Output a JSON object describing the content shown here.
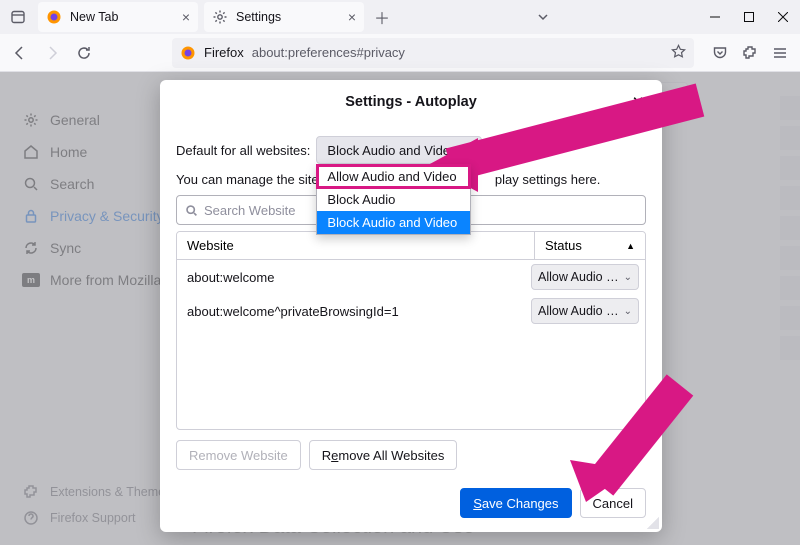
{
  "tabs": [
    {
      "label": "New Tab"
    },
    {
      "label": "Settings"
    }
  ],
  "addressbar": {
    "identity": "Firefox",
    "url": "about:preferences#privacy"
  },
  "sidebar": {
    "items": [
      {
        "label": "General"
      },
      {
        "label": "Home"
      },
      {
        "label": "Search"
      },
      {
        "label": "Privacy & Security"
      },
      {
        "label": "Sync"
      },
      {
        "label": "More from Mozilla"
      }
    ],
    "bottom": [
      {
        "label": "Extensions & Themes"
      },
      {
        "label": "Firefox Support"
      }
    ]
  },
  "ghost_heading": "Firefox Data Collection and Use",
  "modal": {
    "title": "Settings - Autoplay",
    "default_label": "Default for all websites:",
    "default_value": "Block Audio and Video",
    "default_options": [
      "Allow Audio and Video",
      "Block Audio",
      "Block Audio and Video"
    ],
    "manage_text_pre": "You can manage the site",
    "manage_text_post": "play settings here.",
    "search_placeholder": "Search Website",
    "table": {
      "headers": {
        "website": "Website",
        "status": "Status"
      },
      "rows": [
        {
          "website": "about:welcome",
          "status": "Allow Audio …"
        },
        {
          "website": "about:welcome^privateBrowsingId=1",
          "status": "Allow Audio …"
        }
      ]
    },
    "buttons": {
      "remove": "Remove Website",
      "remove_all": "Remove All Websites",
      "save": "Save Changes",
      "cancel": "Cancel"
    }
  },
  "annotation": {
    "color": "#d81884"
  }
}
